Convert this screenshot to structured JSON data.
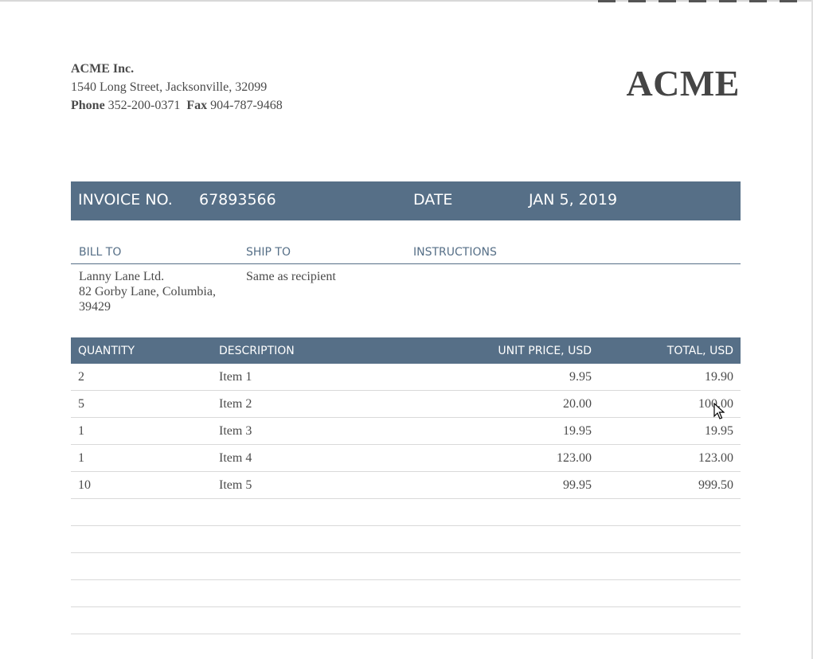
{
  "company": {
    "name": "ACME Inc.",
    "address": "1540  Long Street, Jacksonville, 32099",
    "phone_label": "Phone",
    "phone": "352-200-0371",
    "fax_label": "Fax",
    "fax": "904-787-9468",
    "logo": "ACME"
  },
  "invoice": {
    "number_label": "INVOICE NO.",
    "number": "67893566",
    "date_label": "DATE",
    "date": "JAN 5, 2019"
  },
  "parties": {
    "bill_to_label": "BILL TO",
    "ship_to_label": "SHIP TO",
    "instructions_label": "INSTRUCTIONS",
    "bill_to_line1": "Lanny Lane Ltd.",
    "bill_to_line2": "82  Gorby Lane, Columbia,",
    "bill_to_line3": "39429",
    "ship_to": "Same as recipient",
    "instructions": ""
  },
  "items": {
    "headers": [
      "QUANTITY",
      "DESCRIPTION",
      "UNIT PRICE, USD",
      "TOTAL, USD"
    ],
    "rows": [
      [
        "2",
        "Item 1",
        "9.95",
        "19.90"
      ],
      [
        "5",
        "Item 2",
        "20.00",
        "100.00"
      ],
      [
        "1",
        "Item 3",
        "19.95",
        "19.95"
      ],
      [
        "1",
        "Item 4",
        "123.00",
        "123.00"
      ],
      [
        "10",
        "Item 5",
        "99.95",
        "999.50"
      ],
      [
        "",
        "",
        "",
        ""
      ],
      [
        "",
        "",
        "",
        ""
      ],
      [
        "",
        "",
        "",
        ""
      ],
      [
        "",
        "",
        "",
        ""
      ],
      [
        "",
        "",
        "",
        ""
      ]
    ]
  }
}
